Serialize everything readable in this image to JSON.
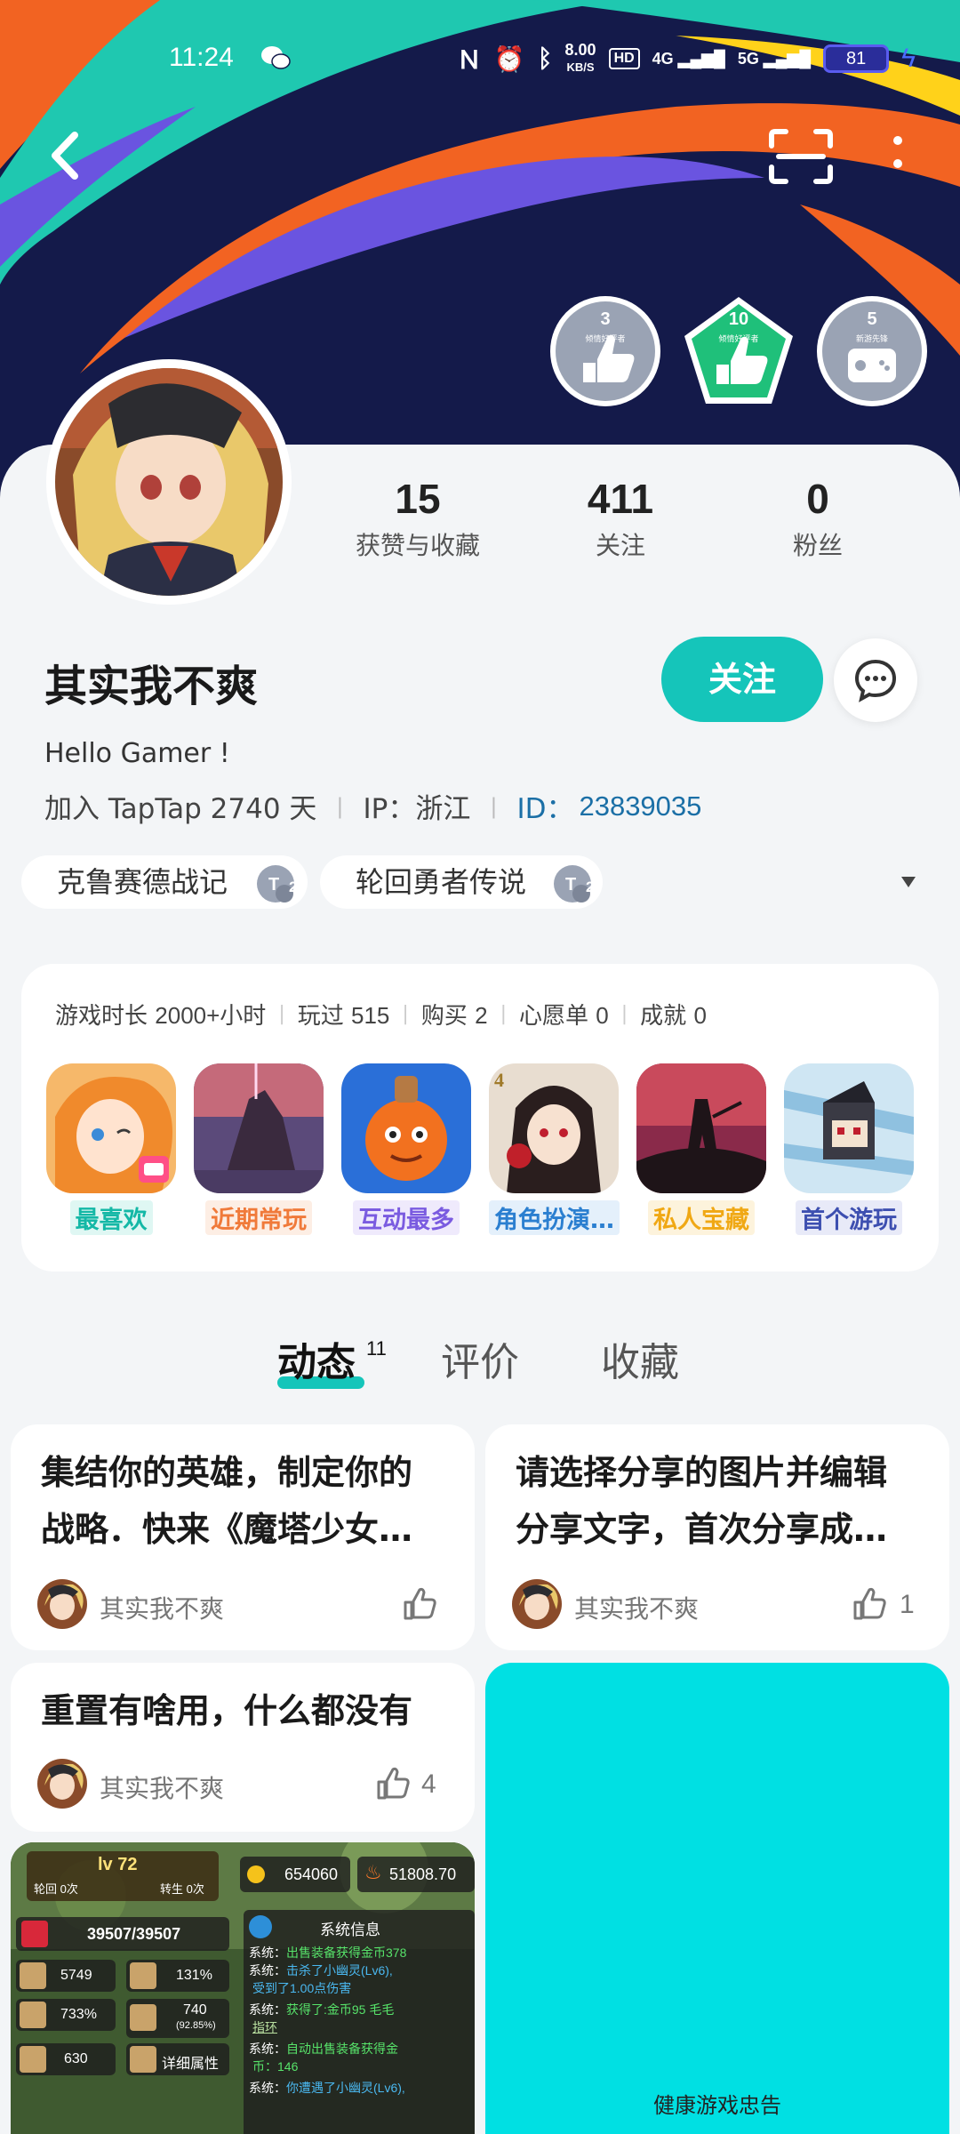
{
  "status_bar": {
    "time": "11:24",
    "net_speed_value": "8.00",
    "net_speed_unit": "KB/S",
    "hd_label": "HD",
    "signal_1": "4G",
    "signal_2": "5G",
    "battery": "81"
  },
  "header": {
    "badges": [
      {
        "number": "3",
        "caption": "倾情好评者",
        "color": "#9aa3b4"
      },
      {
        "number": "10",
        "caption": "倾情好评者",
        "color": "#1fc07a"
      },
      {
        "number": "5",
        "caption": "新游先锋",
        "color": "#9aa3b4"
      }
    ]
  },
  "profile": {
    "stats": [
      {
        "value": "15",
        "label": "获赞与收藏"
      },
      {
        "value": "411",
        "label": "关注"
      },
      {
        "value": "0",
        "label": "粉丝"
      }
    ],
    "username": "其实我不爽",
    "follow_label": "关注",
    "bio": "Hello Gamer !",
    "joined": "加入 TapTap 2740 天",
    "ip": "IP：浙江",
    "id_label": "ID：",
    "id_value": "23839035",
    "tags": [
      {
        "name": "克鲁赛德战记",
        "badge": "2"
      },
      {
        "name": "轮回勇者传说",
        "badge": "2"
      }
    ]
  },
  "game_stats": {
    "playtime_label": "游戏时长",
    "playtime_value": "2000+小时",
    "played_label": "玩过",
    "played_value": "515",
    "bought_label": "购买",
    "bought_value": "2",
    "wishlist_label": "心愿单",
    "wishlist_value": "0",
    "achievements_label": "成就",
    "achievements_value": "0",
    "games": [
      {
        "label": "最喜欢",
        "color": "#14b8a6",
        "bg": "#dff7f3"
      },
      {
        "label": "近期常玩",
        "color": "#f07a3a",
        "bg": "#fdeee4"
      },
      {
        "label": "互动最多",
        "color": "#7a5be0",
        "bg": "#efeafc"
      },
      {
        "label": "角色扮演…",
        "color": "#2b7fd0",
        "bg": "#e4f0fb"
      },
      {
        "label": "私人宝藏",
        "color": "#f0a814",
        "bg": "#fdf3dc"
      },
      {
        "label": "首个游玩",
        "color": "#3d4fb0",
        "bg": "#e8eaf8"
      }
    ]
  },
  "tabs": [
    {
      "label": "动态",
      "count": "11"
    },
    {
      "label": "评价"
    },
    {
      "label": "收藏"
    }
  ],
  "feed": {
    "posts": [
      {
        "line1": "集结你的英雄，制定你的",
        "line2": "战略．快来《魔塔少女…",
        "author": "其实我不爽",
        "likes": ""
      },
      {
        "line1": "请选择分享的图片并编辑",
        "line2": "分享文字，首次分享成…",
        "author": "其实我不爽",
        "likes": "1"
      },
      {
        "line1": "重置有啥用，什么都没有",
        "author": "其实我不爽",
        "likes": "4"
      }
    ],
    "ad_notice": "健康游戏忠告",
    "screenshot": {
      "level": "lv 72",
      "rebirth_l": "轮回 0次",
      "rebirth_r": "转生 0次",
      "gold": "654060",
      "power": "51808.70",
      "hp": "39507/39507",
      "stat1": "5749",
      "stat2": "131%",
      "stat3": "733%",
      "stat4": "740",
      "stat4_sub": "(92.85%)",
      "stat5": "630",
      "detail": "详细属性",
      "sys_title": "系统信息",
      "sys_lines": [
        {
          "prefix": "系统：",
          "text": "出售装备获得金币378"
        },
        {
          "prefix": "系统：",
          "text": "击杀了小幽灵(Lv6),"
        },
        {
          "prefix": "",
          "text": "受到了1.00点伤害"
        },
        {
          "prefix": "系统：",
          "text": "获得了:金币95  毛毛"
        },
        {
          "prefix": "",
          "text": "指环"
        },
        {
          "prefix": "系统：",
          "text": "自动出售装备获得金"
        },
        {
          "prefix": "",
          "text": "币：146"
        },
        {
          "prefix": "系统：",
          "text": "你遭遇了小幽灵(Lv6),"
        }
      ]
    }
  }
}
